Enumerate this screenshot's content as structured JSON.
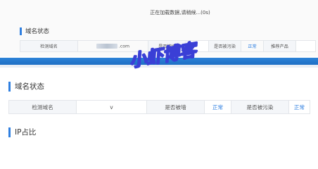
{
  "top": {
    "loading_text": "正在加载数据,请稍候...(0s)",
    "section_title": "域名状态",
    "row": {
      "domain_label": "检测域名",
      "domain_value": ".com",
      "blocked_label": "是否被墙",
      "polluted_label": "是否被污染",
      "polluted_status": "正常",
      "recommend_label": "推荐产品"
    }
  },
  "main": {
    "section_title": "域名状态",
    "row": {
      "domain_label": "检测域名",
      "domain_value": "v",
      "blocked_label": "是否被墙",
      "blocked_status": "正常",
      "polluted_label": "是否被污染",
      "polluted_status": "正常"
    },
    "ip_section_title": "IP占比"
  },
  "watermark": {
    "text": "小虾博客",
    "color": "#3a3fd6"
  },
  "colors": {
    "accent": "#2f7fe0",
    "band": "#1e6fc4"
  }
}
